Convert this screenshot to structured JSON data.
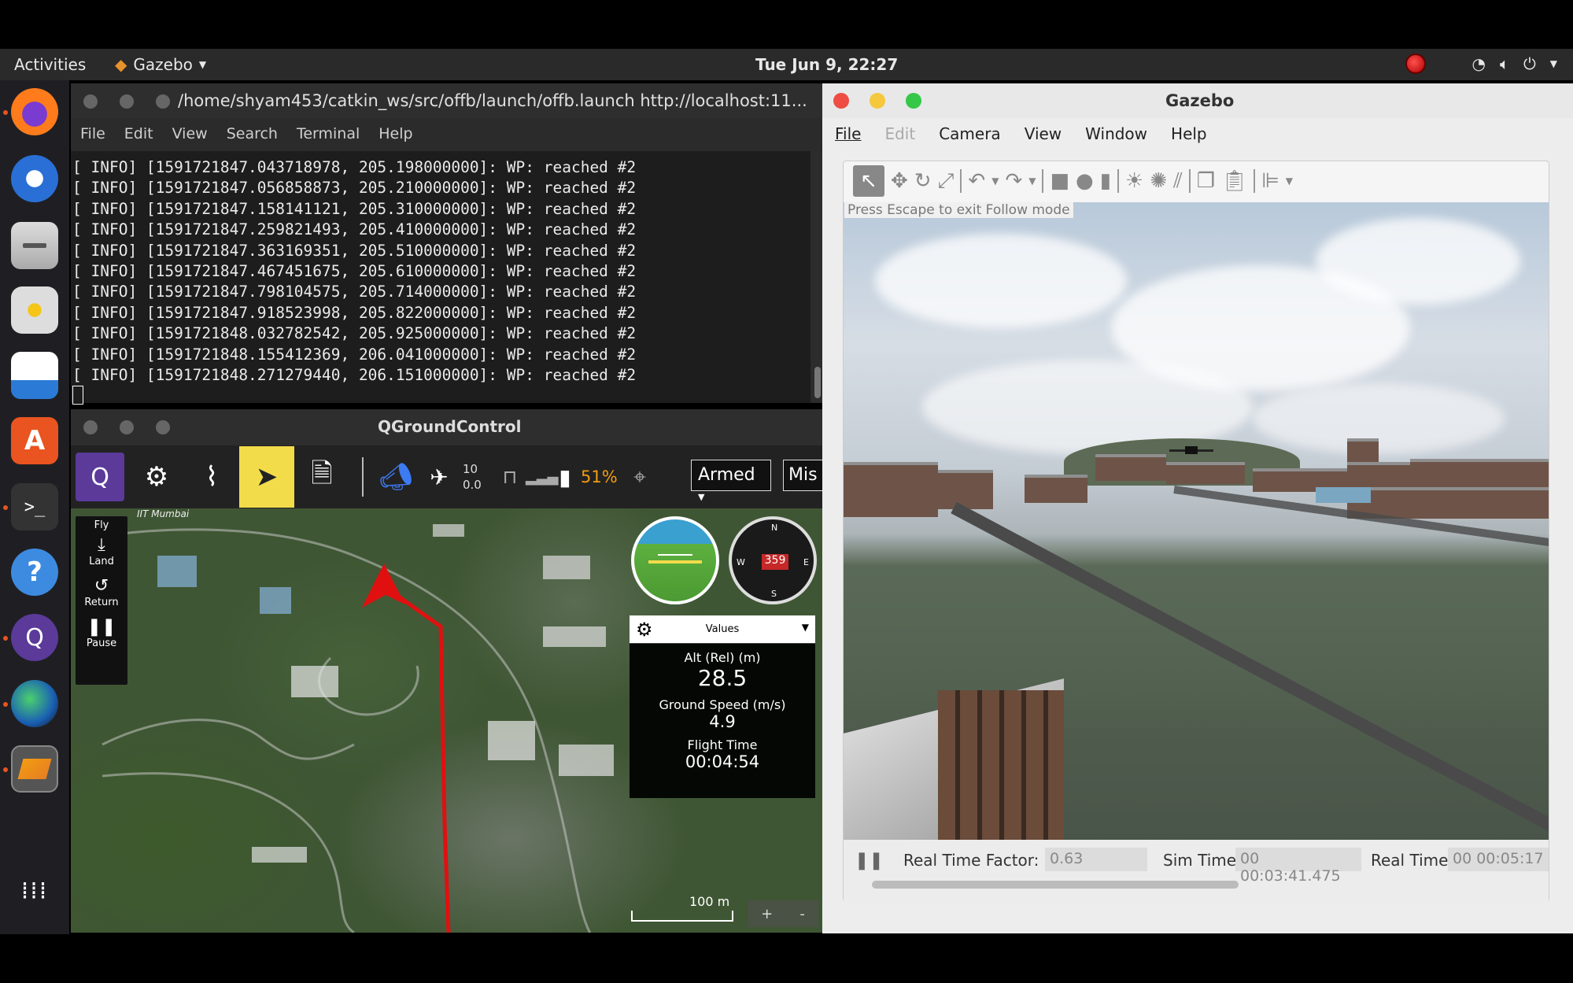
{
  "topbar": {
    "activities": "Activities",
    "app_name": "Gazebo",
    "clock": "Tue Jun  9, 22:27"
  },
  "dock": {
    "items": [
      "firefox-icon",
      "thunderbird-icon",
      "files-icon",
      "rhythmbox-icon",
      "writer-icon",
      "software-icon",
      "terminal-icon",
      "help-icon",
      "qgroundcontrol-icon",
      "globe-icon",
      "gazebo-icon",
      "apps-grid-icon"
    ]
  },
  "terminal": {
    "title": "/home/shyam453/catkin_ws/src/offb/launch/offb.launch http://localhost:11...",
    "menu": [
      "File",
      "Edit",
      "View",
      "Search",
      "Terminal",
      "Help"
    ],
    "lines": [
      "[ INFO] [1591721847.043718978, 205.198000000]: WP: reached #2",
      "[ INFO] [1591721847.056858873, 205.210000000]: WP: reached #2",
      "[ INFO] [1591721847.158141121, 205.310000000]: WP: reached #2",
      "[ INFO] [1591721847.259821493, 205.410000000]: WP: reached #2",
      "[ INFO] [1591721847.363169351, 205.510000000]: WP: reached #2",
      "[ INFO] [1591721847.467451675, 205.610000000]: WP: reached #2",
      "[ INFO] [1591721847.798104575, 205.714000000]: WP: reached #2",
      "[ INFO] [1591721847.918523998, 205.822000000]: WP: reached #2",
      "[ INFO] [1591721848.032782542, 205.925000000]: WP: reached #2",
      "[ INFO] [1591721848.155412369, 206.041000000]: WP: reached #2",
      "[ INFO] [1591721848.271279440, 206.151000000]: WP: reached #2"
    ]
  },
  "qgc": {
    "title": "QGroundControl",
    "gps_count": "10",
    "gps_hdop": "0.0",
    "battery": "51%",
    "armed": "Armed",
    "mission": "Mis",
    "map_label": "IIT Mumbai",
    "fly": {
      "title": "Fly",
      "land": "Land",
      "return": "Return",
      "pause": "Pause"
    },
    "compass": {
      "heading": "359",
      "n": "N",
      "s": "S",
      "e": "E",
      "w": "W"
    },
    "values": {
      "header": "Values",
      "alt_label": "Alt (Rel) (m)",
      "alt": "28.5",
      "gs_label": "Ground Speed (m/s)",
      "gs": "4.9",
      "ft_label": "Flight Time",
      "ft": "00:04:54"
    },
    "scale": "100 m",
    "zoom_in": "+",
    "zoom_out": "-"
  },
  "gazebo": {
    "title": "Gazebo",
    "menu": [
      "File",
      "Edit",
      "Camera",
      "View",
      "Window",
      "Help"
    ],
    "hint": "Press Escape to exit Follow mode",
    "rtf_label": "Real Time Factor:",
    "rtf": "0.63",
    "sim_label": "Sim Time:",
    "sim": "00 00:03:41.475",
    "real_label": "Real Time:",
    "real": "00 00:05:17"
  },
  "colors": {
    "accent_yellow": "#f2dc4a",
    "battery_orange": "#f39c12",
    "path_red": "#e01010",
    "ubuntu_orange": "#e95420"
  }
}
